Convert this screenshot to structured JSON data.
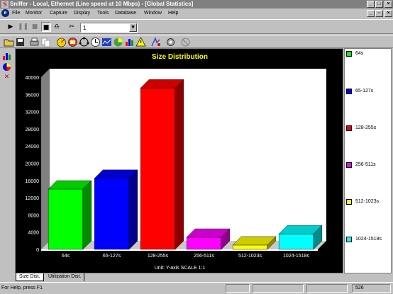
{
  "window": {
    "title": "Sniffer - Local, Ethernet (Line speed at 10 Mbps) - [Global Statistics]",
    "app_icon_letter": "S"
  },
  "menu": [
    "File",
    "Monitor",
    "Capture",
    "Display",
    "Tools",
    "Database",
    "Window",
    "Help"
  ],
  "toolbar": {
    "combo_value": "1"
  },
  "chart_data": {
    "type": "bar",
    "title": "Size Distribution",
    "categories": [
      "64s",
      "65-127s",
      "128-255s",
      "256-511s",
      "512-1023s",
      "1024-1518s"
    ],
    "values": [
      14000,
      16500,
      37500,
      2800,
      1000,
      3600
    ],
    "colors": [
      "#00ff00",
      "#0000ff",
      "#ff0000",
      "#ff00ff",
      "#ffff00",
      "#00ffff"
    ],
    "ylim": [
      0,
      40000
    ],
    "yticks": [
      "0",
      "4000",
      "8000",
      "12000",
      "16000",
      "20000",
      "24000",
      "28000",
      "32000",
      "36000",
      "40000"
    ],
    "unit_text": "Unit:  Y-axis SCALE 1:1",
    "legend_placement": "right",
    "style": "3d"
  },
  "legend": [
    {
      "label": "64s",
      "color": "#00ff00"
    },
    {
      "label": "65-127s",
      "color": "#0000ff"
    },
    {
      "label": "128-255s",
      "color": "#ff0000"
    },
    {
      "label": "256-511s",
      "color": "#ff00ff"
    },
    {
      "label": "512-1023s",
      "color": "#ffff00"
    },
    {
      "label": "1024-1518s",
      "color": "#00ffff"
    }
  ],
  "tabs": [
    {
      "label": "Size Dist.",
      "active": true
    },
    {
      "label": "Utilization Dist.",
      "active": false
    }
  ],
  "status": {
    "help_text": "For Help, press F1",
    "count": "526"
  }
}
